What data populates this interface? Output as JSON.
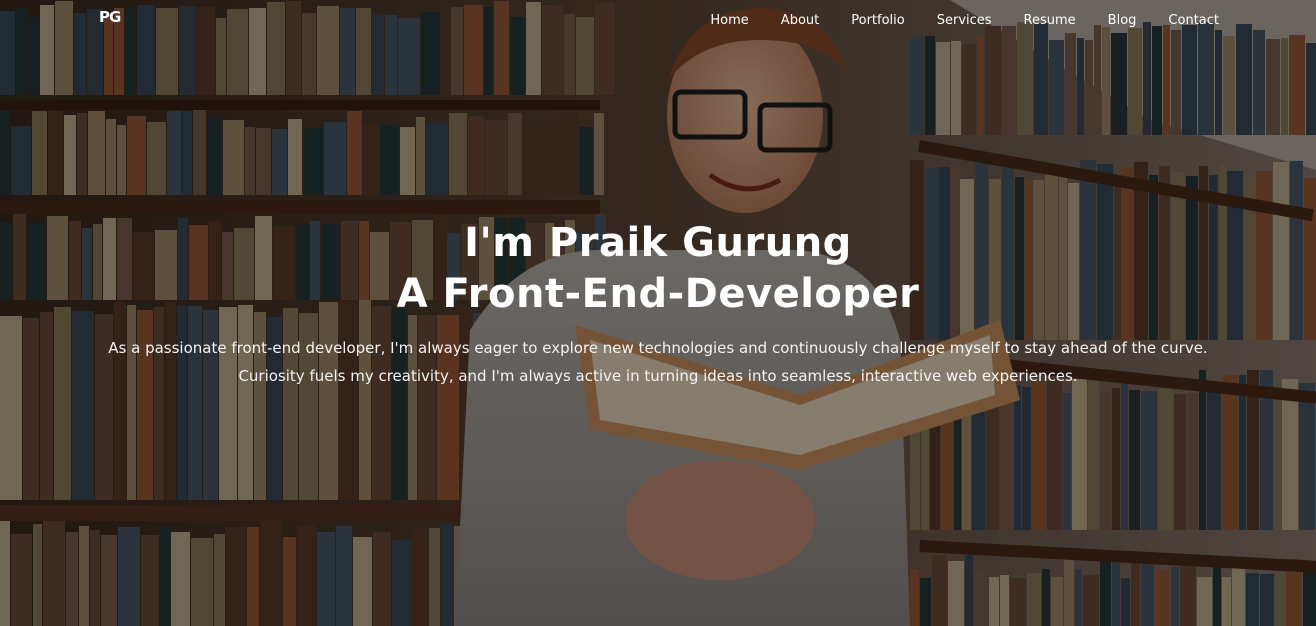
{
  "nav": {
    "logo": "PG",
    "links": [
      "Home",
      "About",
      "Portfolio",
      "Services",
      "Resume",
      "Blog",
      "Contact"
    ]
  },
  "hero": {
    "title_line1": "I'm Praik Gurung",
    "title_line2": "A Front-End-Developer",
    "description": "As a passionate front-end developer, I'm always eager to explore new technologies and continuously challenge myself to stay ahead of the curve. Curiosity fuels my creativity, and I'm always active in turning ideas into seamless, interactive web experiences."
  },
  "colors": {
    "text": "#ffffff",
    "overlay": "rgba(0,0,0,0.42)"
  }
}
